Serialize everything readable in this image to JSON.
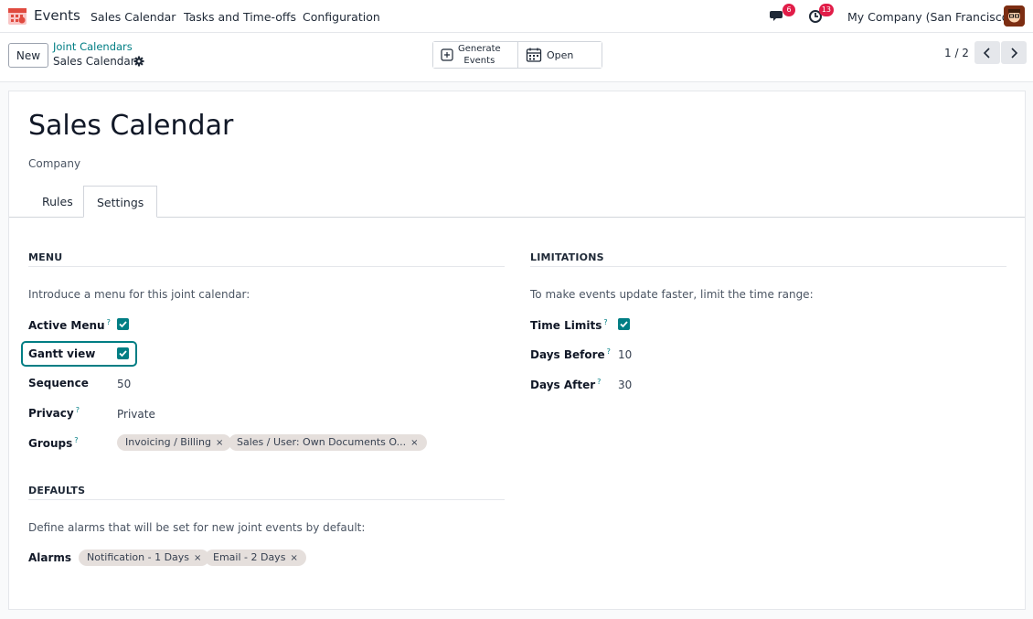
{
  "navbar": {
    "app_name": "Events",
    "menu": [
      "Sales Calendar",
      "Tasks and Time-offs",
      "Configuration"
    ],
    "messages_count": "6",
    "activities_count": "13",
    "company": "My Company (San Francisco)"
  },
  "control": {
    "new_label": "New",
    "breadcrumb_parent": "Joint Calendars",
    "breadcrumb_current": "Sales Calendar",
    "actions": [
      {
        "label": "Generate\nEvents",
        "icon": "plus-square-icon"
      },
      {
        "label": "Open",
        "icon": "calendar-icon"
      }
    ],
    "pager": "1 / 2"
  },
  "form": {
    "title": "Sales Calendar",
    "subtitle": "Company",
    "tabs": [
      "Rules",
      "Settings"
    ],
    "active_tab": "Settings",
    "menu_section": {
      "title": "MENU",
      "intro": "Introduce a menu for this joint calendar:",
      "active_menu": {
        "label": "Active Menu",
        "checked": true
      },
      "gantt_view": {
        "label": "Gantt view",
        "checked": true
      },
      "sequence": {
        "label": "Sequence",
        "value": "50"
      },
      "privacy": {
        "label": "Privacy",
        "value": "Private"
      },
      "groups": {
        "label": "Groups",
        "tags": [
          "Invoicing / Billing",
          "Sales / User: Own Documents O..."
        ]
      }
    },
    "limitations_section": {
      "title": "LIMITATIONS",
      "intro": "To make events update faster, limit the time range:",
      "time_limits": {
        "label": "Time Limits",
        "checked": true
      },
      "days_before": {
        "label": "Days Before",
        "value": "10"
      },
      "days_after": {
        "label": "Days After",
        "value": "30"
      }
    },
    "defaults_section": {
      "title": "DEFAULTS",
      "intro": "Define alarms that will be set for new joint events by default:",
      "alarms": {
        "label": "Alarms",
        "tags": [
          "Notification - 1 Days",
          "Email - 2 Days"
        ]
      }
    },
    "help_marker": "?",
    "tag_remove": "×"
  },
  "colors": {
    "accent": "#017e84",
    "badge": "#e11d48",
    "tag_bg": "#e5dfdc"
  }
}
